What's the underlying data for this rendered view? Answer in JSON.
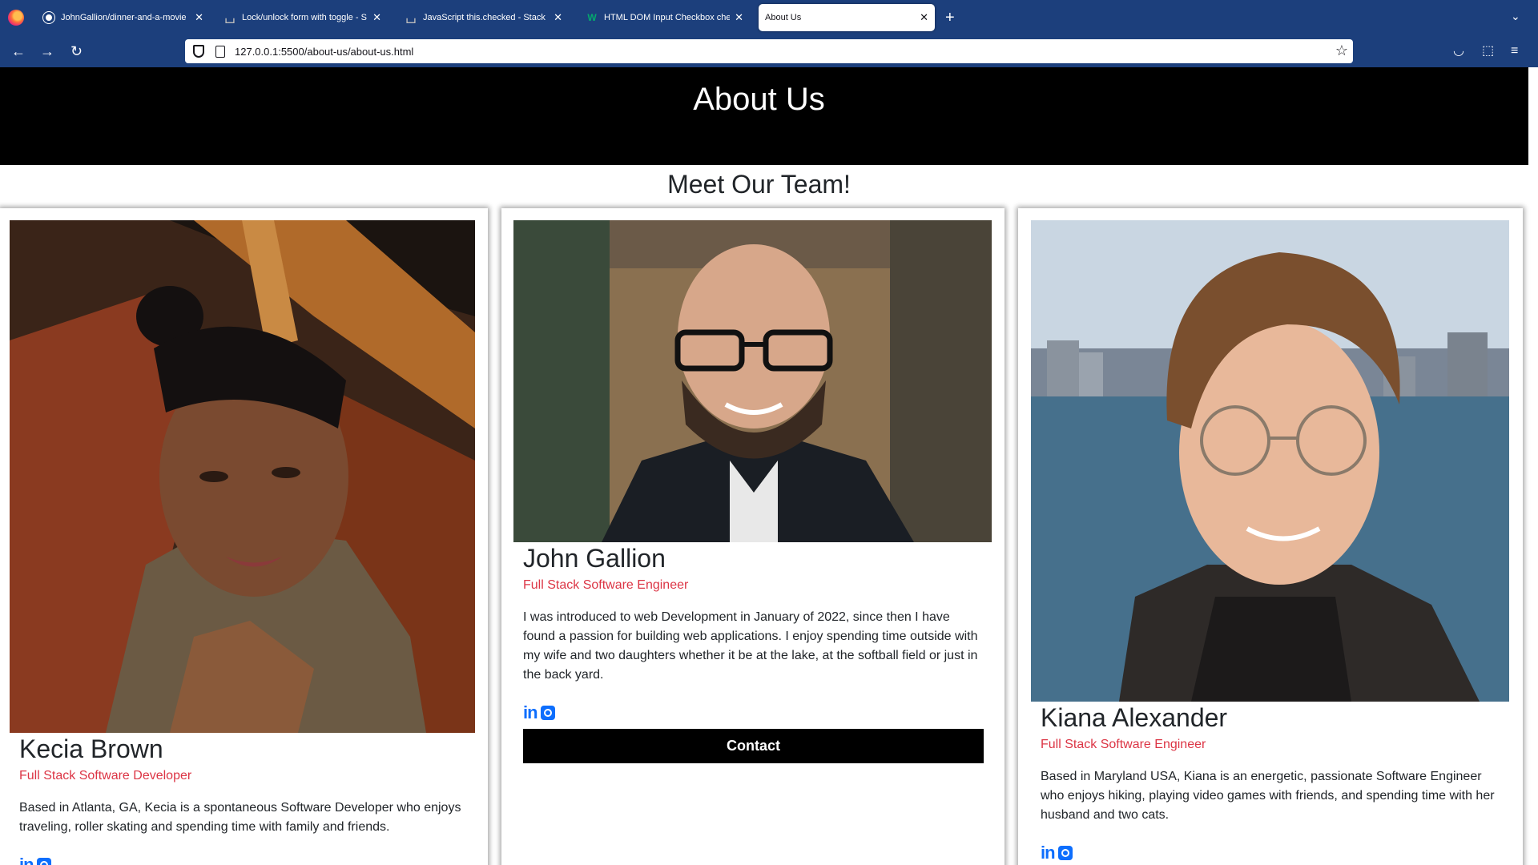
{
  "browser": {
    "tabs": [
      {
        "title": "JohnGallion/dinner-and-a-movie",
        "icon": "github-icon",
        "active": false
      },
      {
        "title": "Lock/unlock form with toggle - S",
        "icon": "stackoverflow-icon",
        "active": false
      },
      {
        "title": "JavaScript this.checked - Stack",
        "icon": "stackoverflow-icon",
        "active": false
      },
      {
        "title": "HTML DOM Input Checkbox che",
        "icon": "w3schools-icon",
        "active": false
      },
      {
        "title": "About Us",
        "icon": "",
        "active": true
      }
    ],
    "url": "127.0.0.1:5500/about-us/about-us.html"
  },
  "page": {
    "title": "About Us",
    "subtitle": "Meet Our Team!",
    "team": [
      {
        "name": "Kecia Brown",
        "role": "Full Stack Software Developer",
        "bio": "Based in Atlanta, GA, Kecia is a spontaneous Software Developer who enjoys traveling, roller skating and spending time with family and friends."
      },
      {
        "name": "John Gallion",
        "role": "Full Stack Software Engineer",
        "bio": "I was introduced to web Development in January of 2022, since then I have found a passion for building web applications. I enjoy spending time outside with my wife and two daughters whether it be at the lake, at the softball field or just in the back yard.",
        "button": "Contact"
      },
      {
        "name": "Kiana Alexander",
        "role": "Full Stack Software Engineer",
        "bio": "Based in Maryland USA, Kiana is an energetic, passionate Software Engineer who enjoys hiking, playing video games with friends, and spending time with her husband and two cats."
      }
    ],
    "social_labels": {
      "linkedin": "in"
    }
  }
}
